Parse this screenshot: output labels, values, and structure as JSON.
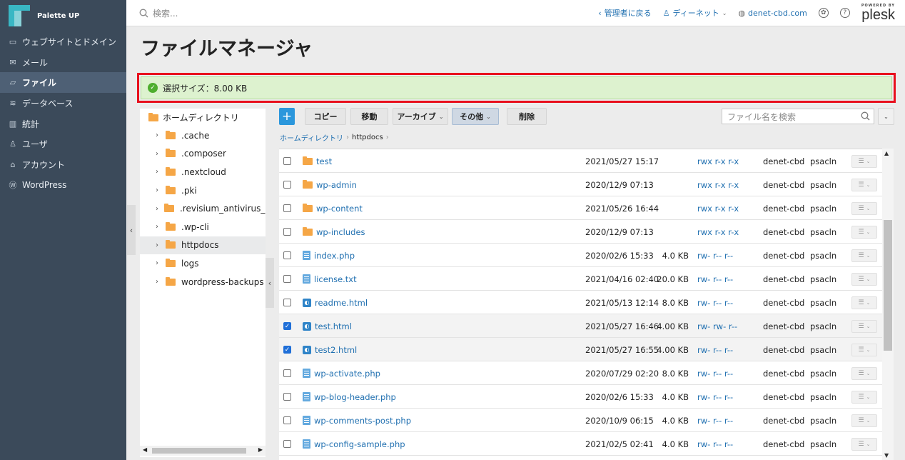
{
  "brand": {
    "name": "Palette UP"
  },
  "sidebar": {
    "items": [
      {
        "label": "ウェブサイトとドメイン",
        "icon": "monitor-icon",
        "glyph": "▭"
      },
      {
        "label": "メール",
        "icon": "mail-icon",
        "glyph": "✉"
      },
      {
        "label": "ファイル",
        "icon": "folder-icon",
        "glyph": "▱",
        "active": true
      },
      {
        "label": "データベース",
        "icon": "database-icon",
        "glyph": "≋"
      },
      {
        "label": "統計",
        "icon": "stats-icon",
        "glyph": "▥"
      },
      {
        "label": "ユーザ",
        "icon": "user-icon",
        "glyph": "♙"
      },
      {
        "label": "アカウント",
        "icon": "account-icon",
        "glyph": "⌂"
      },
      {
        "label": "WordPress",
        "icon": "wordpress-icon",
        "glyph": "Ⓦ"
      }
    ]
  },
  "topbar": {
    "search_placeholder": "検索...",
    "back_admin": "管理者に戻る",
    "user": "ディーネット",
    "domain": "denet-cbd.com",
    "powered_by": "POWERED BY",
    "plesk": "plesk"
  },
  "page": {
    "title": "ファイルマネージャ"
  },
  "notice": {
    "text": "選択サイズ：8.00 KB"
  },
  "tree": {
    "root": "ホームディレクトリ",
    "items": [
      {
        "name": ".cache"
      },
      {
        "name": ".composer"
      },
      {
        "name": ".nextcloud"
      },
      {
        "name": ".pki"
      },
      {
        "name": ".revisium_antivirus_cache"
      },
      {
        "name": ".wp-cli"
      },
      {
        "name": "httpdocs",
        "active": true
      },
      {
        "name": "logs"
      },
      {
        "name": "wordpress-backups"
      }
    ]
  },
  "toolbar": {
    "add_label": "+",
    "copy": "コピー",
    "move": "移動",
    "archive": "アーカイブ",
    "other": "その他",
    "delete": "削除",
    "search_placeholder": "ファイル名を検索"
  },
  "breadcrumb": {
    "home": "ホームディレクトリ",
    "current": "httpdocs",
    "separator": "›"
  },
  "files": [
    {
      "name": "test",
      "type": "folder",
      "date": "2021/05/27 15:17",
      "size": "",
      "perm": "rwx r-x r-x",
      "user": "denet-cbd",
      "group": "psacln",
      "checked": false
    },
    {
      "name": "wp-admin",
      "type": "folder",
      "date": "2020/12/9 07:13",
      "size": "",
      "perm": "rwx r-x r-x",
      "user": "denet-cbd",
      "group": "psacln",
      "checked": false
    },
    {
      "name": "wp-content",
      "type": "folder",
      "date": "2021/05/26 16:44",
      "size": "",
      "perm": "rwx r-x r-x",
      "user": "denet-cbd",
      "group": "psacln",
      "checked": false
    },
    {
      "name": "wp-includes",
      "type": "folder",
      "date": "2020/12/9 07:13",
      "size": "",
      "perm": "rwx r-x r-x",
      "user": "denet-cbd",
      "group": "psacln",
      "checked": false
    },
    {
      "name": "index.php",
      "type": "file",
      "date": "2020/02/6 15:33",
      "size": "4.0 KB",
      "perm": "rw- r-- r--",
      "user": "denet-cbd",
      "group": "psacln",
      "checked": false
    },
    {
      "name": "license.txt",
      "type": "file",
      "date": "2021/04/16 02:40",
      "size": "20.0 KB",
      "perm": "rw- r-- r--",
      "user": "denet-cbd",
      "group": "psacln",
      "checked": false
    },
    {
      "name": "readme.html",
      "type": "html",
      "date": "2021/05/13 12:14",
      "size": "8.0 KB",
      "perm": "rw- r-- r--",
      "user": "denet-cbd",
      "group": "psacln",
      "checked": false
    },
    {
      "name": "test.html",
      "type": "html",
      "date": "2021/05/27 16:46",
      "size": "4.00 KB",
      "perm": "rw- rw- r--",
      "user": "denet-cbd",
      "group": "psacln",
      "checked": true
    },
    {
      "name": "test2.html",
      "type": "html",
      "date": "2021/05/27 16:55",
      "size": "4.00 KB",
      "perm": "rw- r-- r--",
      "user": "denet-cbd",
      "group": "psacln",
      "checked": true
    },
    {
      "name": "wp-activate.php",
      "type": "file",
      "date": "2020/07/29 02:20",
      "size": "8.0 KB",
      "perm": "rw- r-- r--",
      "user": "denet-cbd",
      "group": "psacln",
      "checked": false
    },
    {
      "name": "wp-blog-header.php",
      "type": "file",
      "date": "2020/02/6 15:33",
      "size": "4.0 KB",
      "perm": "rw- r-- r--",
      "user": "denet-cbd",
      "group": "psacln",
      "checked": false
    },
    {
      "name": "wp-comments-post.php",
      "type": "file",
      "date": "2020/10/9 06:15",
      "size": "4.0 KB",
      "perm": "rw- r-- r--",
      "user": "denet-cbd",
      "group": "psacln",
      "checked": false
    },
    {
      "name": "wp-config-sample.php",
      "type": "file",
      "date": "2021/02/5 02:41",
      "size": "4.0 KB",
      "perm": "rw- r-- r--",
      "user": "denet-cbd",
      "group": "psacln",
      "checked": false
    }
  ],
  "colors": {
    "accent": "#2b97dc",
    "link": "#1f6fb0",
    "highlight_border": "#e8101d",
    "success_bg": "#ddf2cf",
    "sidebar_bg": "#3b4a5a"
  }
}
